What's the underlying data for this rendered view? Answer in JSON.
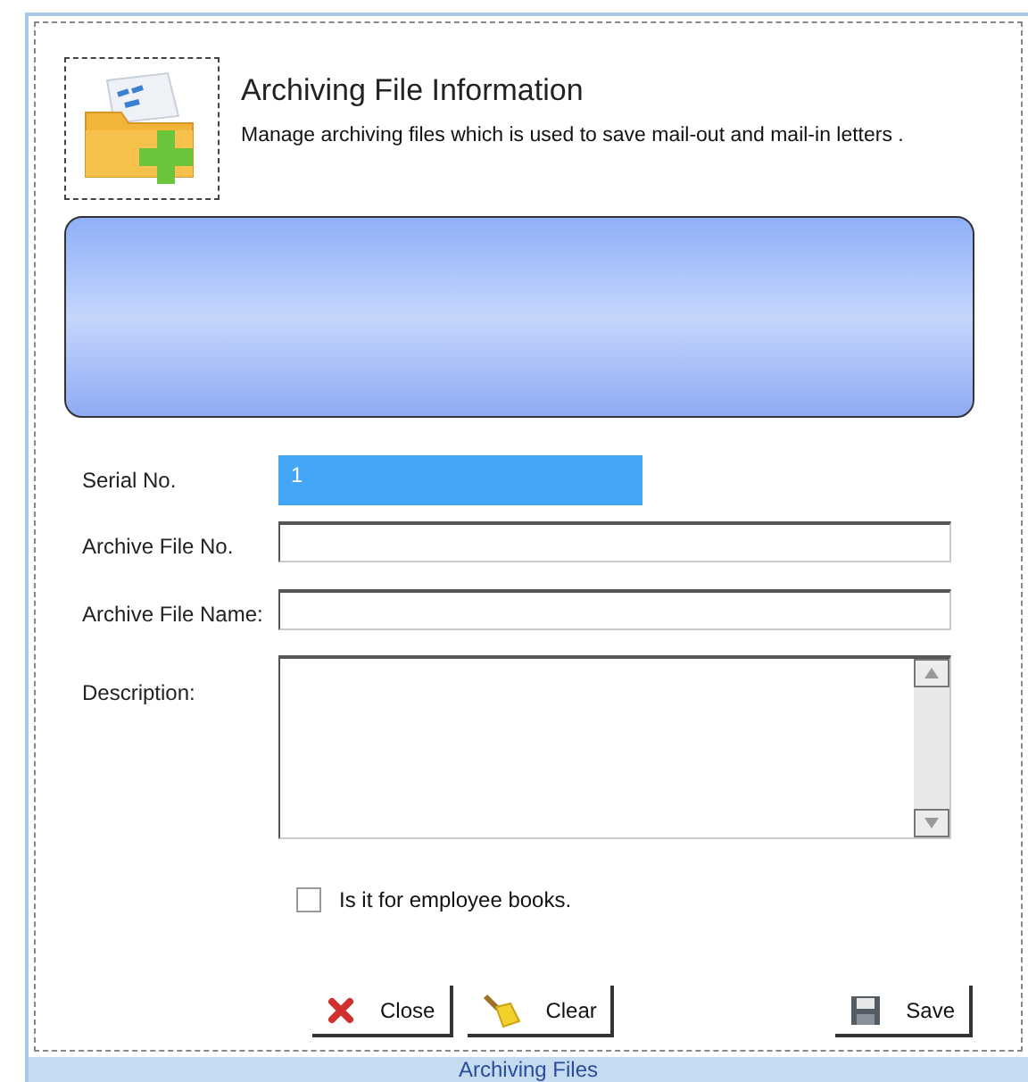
{
  "header": {
    "title": "Archiving File Information",
    "subtitle": "Manage archiving files which is used to save mail-out and mail-in letters ."
  },
  "fields": [
    {
      "label": "Serial No.",
      "kind": "highlighted",
      "value": "1"
    },
    {
      "label": "Archive File No.",
      "kind": "text"
    },
    {
      "label": "Archive File Name:",
      "kind": "text"
    },
    {
      "label": "Description:",
      "kind": "textarea"
    }
  ],
  "checkbox": {
    "label": "Is it for employee books.",
    "checked": false
  },
  "buttons": [
    {
      "label": "Close",
      "kind": "close"
    },
    {
      "label": "Clear",
      "kind": "clear"
    },
    {
      "label": "Save",
      "kind": "save"
    }
  ],
  "status_bar": {
    "title": "Archiving Files"
  }
}
